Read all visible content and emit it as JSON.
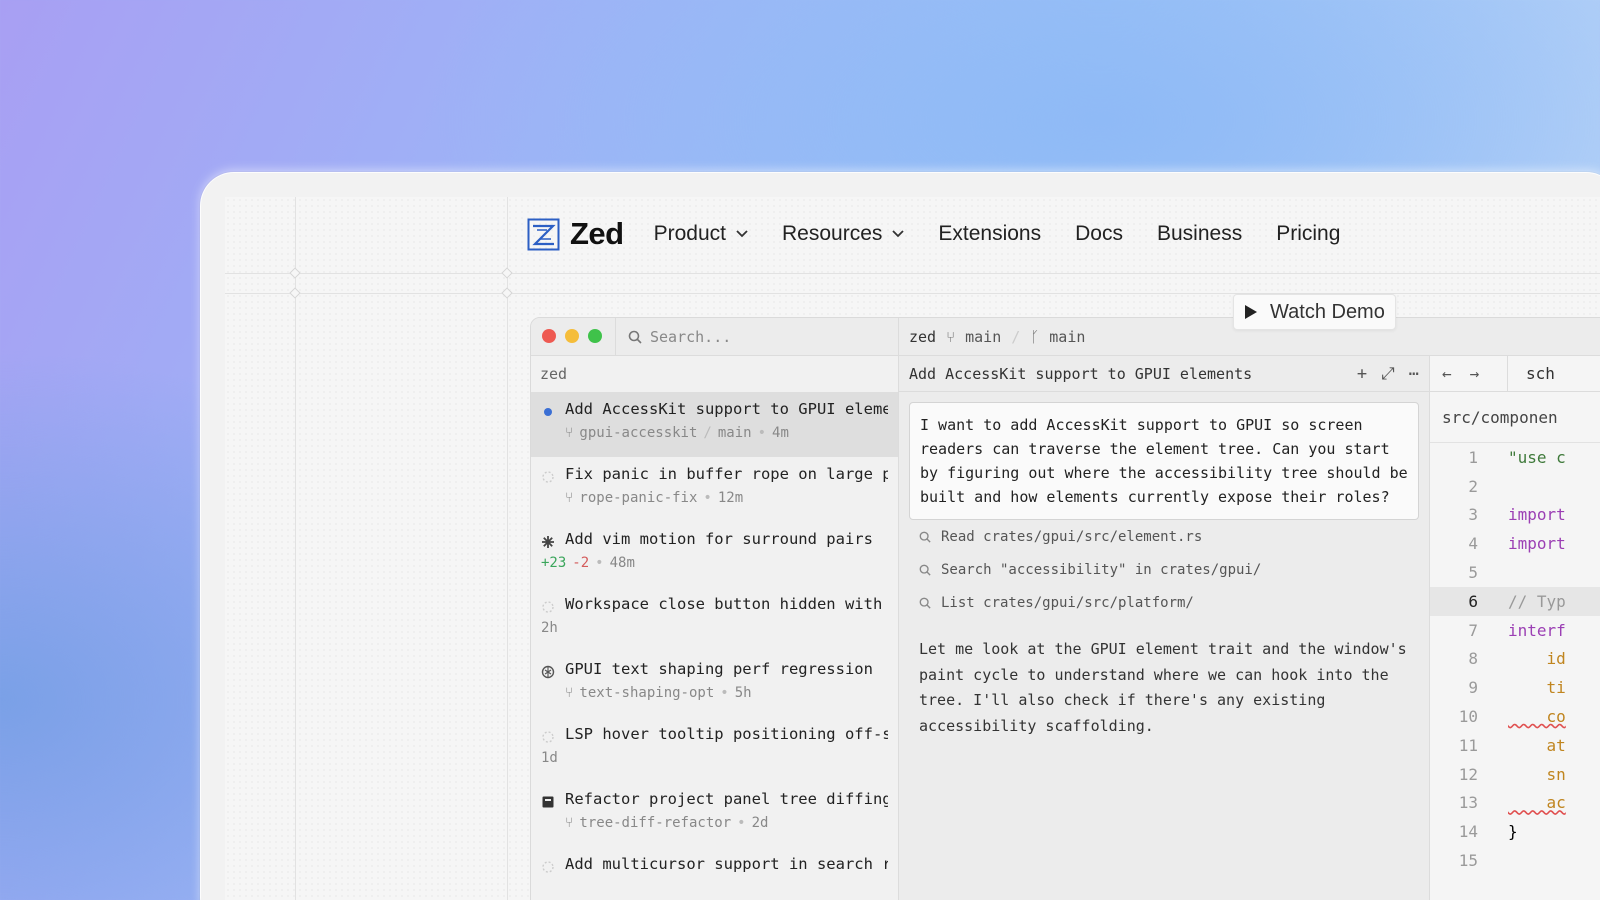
{
  "brand": {
    "name": "Zed"
  },
  "nav": {
    "items": [
      {
        "label": "Product",
        "dropdown": true
      },
      {
        "label": "Resources",
        "dropdown": true
      },
      {
        "label": "Extensions",
        "dropdown": false
      },
      {
        "label": "Docs",
        "dropdown": false
      },
      {
        "label": "Business",
        "dropdown": false
      },
      {
        "label": "Pricing",
        "dropdown": false
      }
    ]
  },
  "watch_demo": {
    "label": "Watch Demo"
  },
  "editor": {
    "search_placeholder": "Search...",
    "breadcrumb": {
      "project": "zed",
      "worktree": "main",
      "branch": "main"
    },
    "sidebar": {
      "header": "zed",
      "threads": [
        {
          "title": "Add AccessKit support to GPUI eleme...",
          "branch": "gpui-accesskit",
          "base": "main",
          "time": "4m",
          "active": true,
          "icon": "blue-dot-icon"
        },
        {
          "title": "Fix panic in buffer rope on large paste",
          "branch": "rope-panic-fix",
          "time": "12m",
          "icon": "idle-spinner-icon"
        },
        {
          "title": "Add vim motion for surround pairs",
          "added": "+23",
          "removed": "-2",
          "time": "48m",
          "icon": "running-spinner-icon"
        },
        {
          "title": "Workspace close button hidden with ...",
          "time": "2h",
          "icon": "idle-spinner-icon"
        },
        {
          "title": "GPUI text shaping perf regression",
          "branch": "text-shaping-opt",
          "time": "5h",
          "icon": "openai-logo-icon"
        },
        {
          "title": "LSP hover tooltip positioning off-scr...",
          "time": "1d",
          "icon": "idle-spinner-icon"
        },
        {
          "title": "Refactor project panel tree diffing",
          "branch": "tree-diff-refactor",
          "time": "2d",
          "icon": "dark-square-icon"
        },
        {
          "title": "Add multicursor support in search re...",
          "icon": "idle-spinner-icon"
        }
      ]
    },
    "agent": {
      "title": "Add AccessKit support to GPUI elements",
      "prompt": "I want to add AccessKit support to GPUI so screen readers can traverse the element tree. Can you start by figuring out where the accessibility tree should be built and how elements currently expose their roles?",
      "tools": [
        "Read crates/gpui/src/element.rs",
        "Search \"accessibility\" in crates/gpui/",
        "List crates/gpui/src/platform/"
      ],
      "reply": "Let me look at the GPUI element trait and the window's paint cycle to understand where we can hook into the tree. I'll also check if there's any existing accessibility scaffolding."
    },
    "code": {
      "tab": "sch",
      "path": "src/componen",
      "lines": [
        {
          "n": "1",
          "text": "\"use c",
          "cls": "str"
        },
        {
          "n": "2",
          "text": "",
          "cls": ""
        },
        {
          "n": "3",
          "text": "import",
          "cls": "kw"
        },
        {
          "n": "4",
          "text": "import",
          "cls": "kw"
        },
        {
          "n": "5",
          "text": "",
          "cls": ""
        },
        {
          "n": "6",
          "text": "// Typ",
          "cls": "cm",
          "current": true
        },
        {
          "n": "7",
          "text": "interf",
          "cls": "kw"
        },
        {
          "n": "8",
          "text": "    id",
          "cls": "prop"
        },
        {
          "n": "9",
          "text": "    ti",
          "cls": "prop"
        },
        {
          "n": "10",
          "text": "    co",
          "cls": "err"
        },
        {
          "n": "11",
          "text": "    at",
          "cls": "prop"
        },
        {
          "n": "12",
          "text": "    sn",
          "cls": "prop"
        },
        {
          "n": "13",
          "text": "    ac",
          "cls": "err"
        },
        {
          "n": "14",
          "text": "}",
          "cls": ""
        },
        {
          "n": "15",
          "text": "",
          "cls": ""
        }
      ]
    }
  },
  "colors": {
    "accent": "#3b6fd4",
    "traffic_red": "#ee5a52",
    "traffic_yellow": "#f5bd3a",
    "traffic_green": "#3fc24a"
  }
}
